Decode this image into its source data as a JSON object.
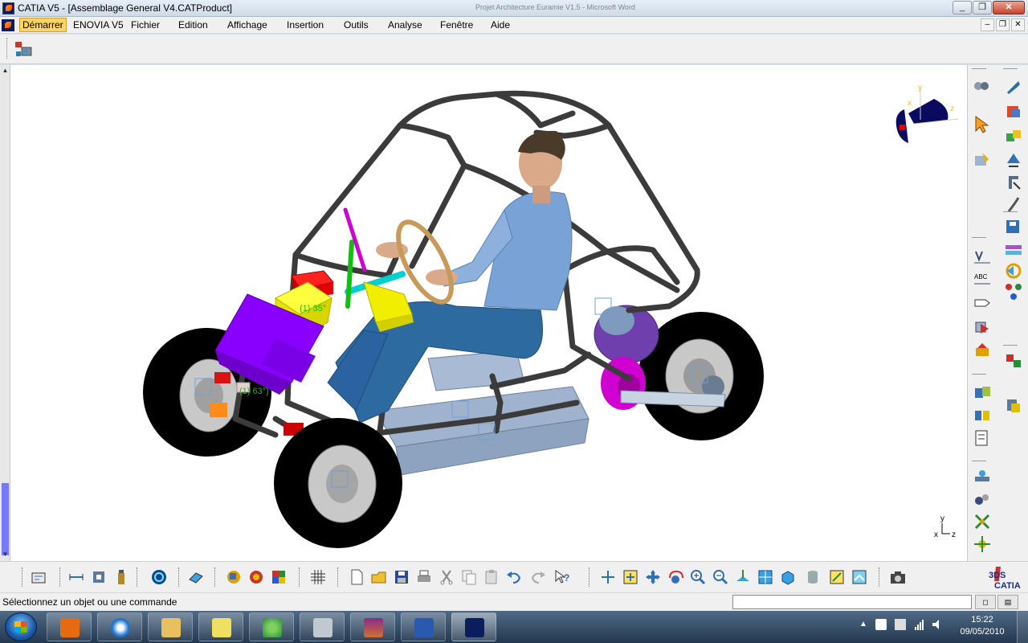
{
  "window": {
    "title": "CATIA V5 - [Assemblage General V4.CATProduct]",
    "background_title": "Projet Architecture Euramie V1.5 - Microsoft Word",
    "controls": [
      "minimize",
      "restore",
      "close"
    ]
  },
  "menubar": {
    "items": [
      "Démarrer",
      "ENOVIA V5",
      "Fichier",
      "Edition",
      "Affichage",
      "Insertion",
      "Outils",
      "Analyse",
      "Fenêtre",
      "Aide"
    ],
    "active_item": "Démarrer"
  },
  "toolbar_top": {
    "icons": [
      "product-structure-icon"
    ]
  },
  "viewport": {
    "scene": "3D assembly model of a tubular-frame buggy with seated driver mannequin",
    "annotations": [
      "(1) 35°",
      "(1) 63°)"
    ],
    "axis_labels": {
      "x": "x",
      "y": "y",
      "z": "z"
    },
    "compass_labels": {
      "x": "x",
      "y": "y",
      "z": "z"
    },
    "colors": {
      "frame": "#3b3b3b",
      "tire": "#000000",
      "rim": "#c8c8c8",
      "purple_box": "#8a00ff",
      "yellow_box": "#f2ee00",
      "red_box": "#e00000",
      "magenta_part": "#d000d0",
      "seat": "#9fb3cf",
      "shirt": "#79a2d6",
      "jeans": "#2d6aa0",
      "steering_wheel": "#c89a5a"
    }
  },
  "right_toolbar": {
    "icons": [
      "spring-icon",
      "spanner-icon",
      "select-arrow-icon",
      "product-icon",
      "snap-icon",
      "fix-icon",
      "clash-icon",
      "replace-icon",
      "measure-icon",
      "text-annotation-icon",
      "flag-note-icon",
      "view-icon",
      "save-management-icon",
      "bill-of-material-icon",
      "scene-icon",
      "exploded-view-icon",
      "constraint-icon",
      "catalog-icon",
      "tree-icon",
      "update-icon"
    ]
  },
  "bottom_toolbar": {
    "icons": [
      "update-all-icon",
      "distance-icon",
      "measure-item-icon",
      "inertia-icon",
      "swirl-icon",
      "drawing-icon",
      "render-icon",
      "apply-material-icon",
      "scene-colors-icon",
      "grid-icon",
      "new-icon",
      "open-icon",
      "save-icon",
      "print-icon",
      "cut-icon",
      "copy-icon",
      "paste-icon",
      "undo-icon",
      "redo-icon",
      "whats-this-icon",
      "fly-icon",
      "fit-all-icon",
      "pan-icon",
      "rotate-icon",
      "zoom-in-icon",
      "zoom-out-icon",
      "normal-view-icon",
      "views-icon",
      "render-style-icon",
      "hide-show-icon",
      "swap-icon",
      "visible-space-icon",
      "capture-icon"
    ]
  },
  "statusbar": {
    "message": "Sélectionnez un objet ou une commande",
    "command_input": ""
  },
  "taskbar": {
    "clock_time": "15:22",
    "clock_date": "09/05/2010",
    "apps": [
      "media-player",
      "internet-explorer",
      "file-explorer",
      "sticky-notes",
      "messenger",
      "calculator",
      "winrar",
      "word",
      "catia"
    ]
  },
  "catia_logo": {
    "label": "CATIA",
    "brand": "3DS"
  }
}
